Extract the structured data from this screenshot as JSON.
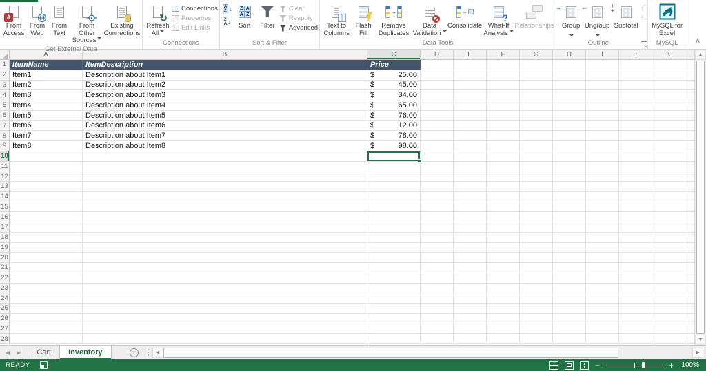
{
  "ribbon": {
    "groups": [
      {
        "label": "Get External Data",
        "buttons": [
          {
            "label": "From Access"
          },
          {
            "label": "From Web"
          },
          {
            "label": "From Text"
          },
          {
            "label": "From Other Sources"
          },
          {
            "label": "Existing Connections"
          }
        ]
      },
      {
        "label": "Connections",
        "buttons": [
          {
            "label": "Refresh All"
          },
          {
            "label": "Connections"
          },
          {
            "label": "Properties"
          },
          {
            "label": "Edit Links"
          }
        ]
      },
      {
        "label": "Sort & Filter",
        "buttons": [
          {
            "label": "Sort"
          },
          {
            "label": "Filter"
          },
          {
            "label": "Clear"
          },
          {
            "label": "Reapply"
          },
          {
            "label": "Advanced"
          }
        ]
      },
      {
        "label": "Data Tools",
        "buttons": [
          {
            "label": "Text to Columns"
          },
          {
            "label": "Flash Fill"
          },
          {
            "label": "Remove Duplicates"
          },
          {
            "label": "Data Validation"
          },
          {
            "label": "Consolidate"
          },
          {
            "label": "What-If Analysis"
          },
          {
            "label": "Relationships"
          }
        ]
      },
      {
        "label": "Outline",
        "buttons": [
          {
            "label": "Group"
          },
          {
            "label": "Ungroup"
          },
          {
            "label": "Subtotal"
          }
        ]
      },
      {
        "label": "MySQL",
        "buttons": [
          {
            "label": "MySQL for Excel"
          }
        ]
      }
    ]
  },
  "spreadsheet": {
    "columns": [
      "A",
      "B",
      "C",
      "D",
      "E",
      "F",
      "G",
      "H",
      "I",
      "J",
      "K"
    ],
    "total_rows": 28,
    "selected_cell": "C10",
    "selected_column": "C",
    "selected_row": 10,
    "rows": [
      {
        "row": 1,
        "A": "ItemName",
        "B": "ItemDescription",
        "C": "Price",
        "is_header": true
      },
      {
        "row": 2,
        "A": "Item1",
        "B": "Description about Item1",
        "C_currency": "$",
        "C_value": "25.00"
      },
      {
        "row": 3,
        "A": "Item2",
        "B": "Description about Item2",
        "C_currency": "$",
        "C_value": "45.00"
      },
      {
        "row": 4,
        "A": "Item3",
        "B": "Description about Item3",
        "C_currency": "$",
        "C_value": "34.00"
      },
      {
        "row": 5,
        "A": "Item4",
        "B": "Description about Item4",
        "C_currency": "$",
        "C_value": "65.00"
      },
      {
        "row": 6,
        "A": "Item5",
        "B": "Description about Item5",
        "C_currency": "$",
        "C_value": "76.00"
      },
      {
        "row": 7,
        "A": "Item6",
        "B": "Description about Item6",
        "C_currency": "$",
        "C_value": "12.00"
      },
      {
        "row": 8,
        "A": "Item7",
        "B": "Description about Item7",
        "C_currency": "$",
        "C_value": "78.00"
      },
      {
        "row": 9,
        "A": "Item8",
        "B": "Description about Item8",
        "C_currency": "$",
        "C_value": "98.00"
      }
    ]
  },
  "sheet_tabs": {
    "tabs": [
      {
        "label": "Cart",
        "active": false
      },
      {
        "label": "Inventory",
        "active": true
      }
    ]
  },
  "status_bar": {
    "mode": "READY",
    "zoom_level": "100%"
  },
  "colors": {
    "accent_green": "#217346",
    "header_row_fill": "#44546A",
    "active_tab_text": "#1E6B41"
  }
}
